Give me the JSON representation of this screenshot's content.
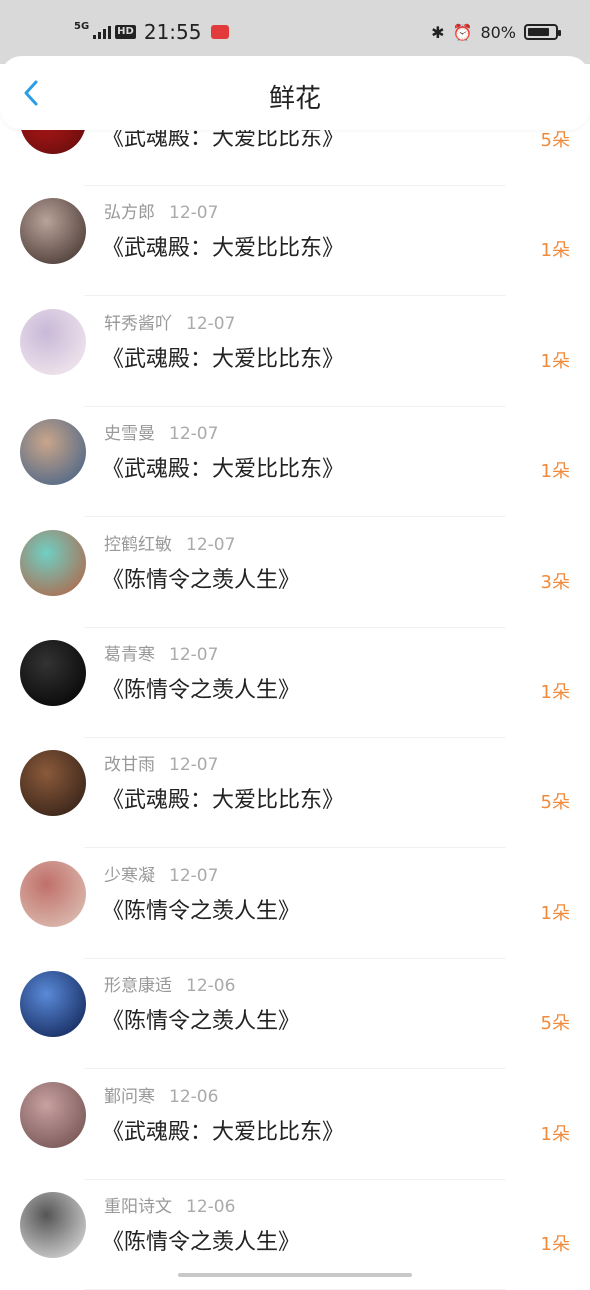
{
  "status_bar": {
    "network": "5G",
    "hd": "HD",
    "time": "21:55",
    "battery": "80%",
    "battery_level": 0.8
  },
  "header": {
    "title": "鲜花"
  },
  "rows": [
    {
      "name": "",
      "date": "",
      "book": "《武魂殿：大爱比比东》",
      "count": "5朵",
      "avatar_colors": [
        "#5a0b0b",
        "#c21a1a"
      ]
    },
    {
      "name": "弘方郎",
      "date": "12-07",
      "book": "《武魂殿：大爱比比东》",
      "count": "1朵",
      "avatar_colors": [
        "#3a2a26",
        "#b9a39a"
      ]
    },
    {
      "name": "轩秀酱吖",
      "date": "12-07",
      "book": "《武魂殿：大爱比比东》",
      "count": "1朵",
      "avatar_colors": [
        "#f7eef0",
        "#c9b8d8"
      ]
    },
    {
      "name": "史雪曼",
      "date": "12-07",
      "book": "《武魂殿：大爱比比东》",
      "count": "1朵",
      "avatar_colors": [
        "#3a5d86",
        "#c9a58a"
      ]
    },
    {
      "name": "控鹤红敏",
      "date": "12-07",
      "book": "《陈情令之羡人生》",
      "count": "3朵",
      "avatar_colors": [
        "#b85a3c",
        "#70cfc3"
      ]
    },
    {
      "name": "葛青寒",
      "date": "12-07",
      "book": "《陈情令之羡人生》",
      "count": "1朵",
      "avatar_colors": [
        "#000000",
        "#333333"
      ]
    },
    {
      "name": "改甘雨",
      "date": "12-07",
      "book": "《武魂殿：大爱比比东》",
      "count": "5朵",
      "avatar_colors": [
        "#2a1a14",
        "#8a5a3a"
      ]
    },
    {
      "name": "少寒凝",
      "date": "12-07",
      "book": "《陈情令之羡人生》",
      "count": "1朵",
      "avatar_colors": [
        "#e0c8bc",
        "#c0706a"
      ]
    },
    {
      "name": "形意康适",
      "date": "12-06",
      "book": "《陈情令之羡人生》",
      "count": "5朵",
      "avatar_colors": [
        "#0a1a4a",
        "#5a8ad8"
      ]
    },
    {
      "name": "鄞问寒",
      "date": "12-06",
      "book": "《武魂殿：大爱比比东》",
      "count": "1朵",
      "avatar_colors": [
        "#6a4a4a",
        "#c8a0a0"
      ]
    },
    {
      "name": "重阳诗文",
      "date": "12-06",
      "book": "《陈情令之羡人生》",
      "count": "1朵",
      "avatar_colors": [
        "#e8e8e8",
        "#555555"
      ]
    }
  ]
}
